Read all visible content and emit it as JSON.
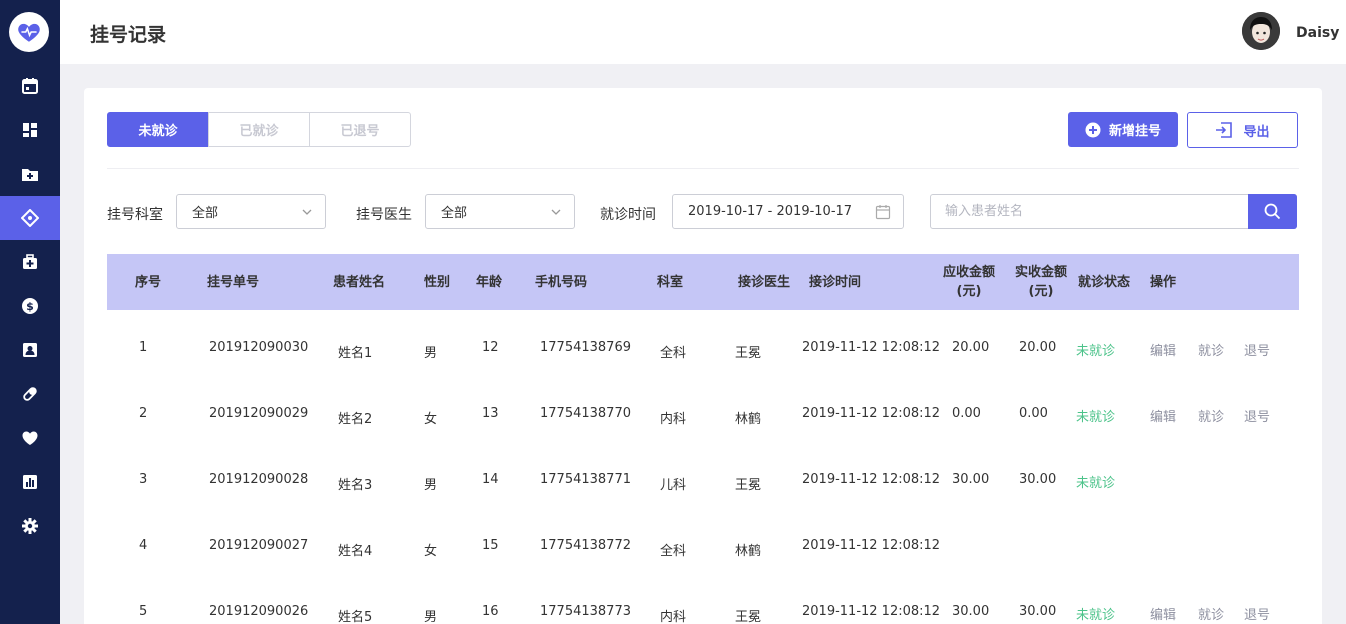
{
  "sidebar": {
    "items": [
      {
        "icon": "calendar-icon",
        "active": false
      },
      {
        "icon": "dashboard-icon",
        "active": false
      },
      {
        "icon": "folder-add-icon",
        "active": false
      },
      {
        "icon": "diamond-nav-icon",
        "active": true
      },
      {
        "icon": "medical-kit-icon",
        "active": false
      },
      {
        "icon": "dollar-icon",
        "active": false
      },
      {
        "icon": "contact-card-icon",
        "active": false
      },
      {
        "icon": "pill-icon",
        "active": false
      },
      {
        "icon": "heart-icon",
        "active": false
      },
      {
        "icon": "bar-chart-icon",
        "active": false
      },
      {
        "icon": "settings-icon",
        "active": false
      }
    ]
  },
  "header": {
    "title": "挂号记录",
    "username": "Daisy"
  },
  "tabs": [
    "未就诊",
    "已就诊",
    "已退号"
  ],
  "actions": {
    "add_label": "新增挂号",
    "export_label": "导出"
  },
  "filters": {
    "dept_label": "挂号科室",
    "dept_value": "全部",
    "doctor_label": "挂号医生",
    "doctor_value": "全部",
    "time_label": "就诊时间",
    "date_range": "2019-10-17 - 2019-10-17",
    "search_placeholder": "输入患者姓名"
  },
  "table": {
    "headers": [
      "序号",
      "挂号单号",
      "患者姓名",
      "性别",
      "年龄",
      "手机号码",
      "科室",
      "接诊医生",
      "接诊时间",
      "应收金额\n(元)",
      "实收金额\n(元)",
      "就诊状态",
      "操作"
    ],
    "rows": [
      {
        "no": "1",
        "reg_no": "201912090030",
        "name": "姓名1",
        "gender": "男",
        "age": "12",
        "phone": "17754138769",
        "dept": "全科",
        "doctor": "王冕",
        "time": "2019-11-12 12:08:12",
        "due": "20.00",
        "paid": "20.00",
        "status": "未就诊",
        "ops": [
          "编辑",
          "就诊",
          "退号"
        ]
      },
      {
        "no": "2",
        "reg_no": "201912090029",
        "name": "姓名2",
        "gender": "女",
        "age": "13",
        "phone": "17754138770",
        "dept": "内科",
        "doctor": "林鹤",
        "time": "2019-11-12 12:08:12",
        "due": "0.00",
        "paid": "0.00",
        "status": "未就诊",
        "ops": [
          "编辑",
          "就诊",
          "退号"
        ]
      },
      {
        "no": "3",
        "reg_no": "201912090028",
        "name": "姓名3",
        "gender": "男",
        "age": "14",
        "phone": "17754138771",
        "dept": "儿科",
        "doctor": "王冕",
        "time": "2019-11-12 12:08:12",
        "due": "30.00",
        "paid": "30.00",
        "status": "未就诊",
        "ops": []
      },
      {
        "no": "4",
        "reg_no": "201912090027",
        "name": "姓名4",
        "gender": "女",
        "age": "15",
        "phone": "17754138772",
        "dept": "全科",
        "doctor": "林鹤",
        "time": "2019-11-12 12:08:12",
        "due": "",
        "paid": "",
        "status": "",
        "ops": []
      },
      {
        "no": "5",
        "reg_no": "201912090026",
        "name": "姓名5",
        "gender": "男",
        "age": "16",
        "phone": "17754138773",
        "dept": "内科",
        "doctor": "王冕",
        "time": "2019-11-12 12:08:12",
        "due": "30.00",
        "paid": "30.00",
        "status": "未就诊",
        "ops": [
          "编辑",
          "就诊",
          "退号"
        ]
      }
    ]
  },
  "colors": {
    "sidebar_bg": "#14214d",
    "accent": "#5b61e8",
    "table_header_bg": "#c5c6f6",
    "status_green": "#4cc38a"
  }
}
